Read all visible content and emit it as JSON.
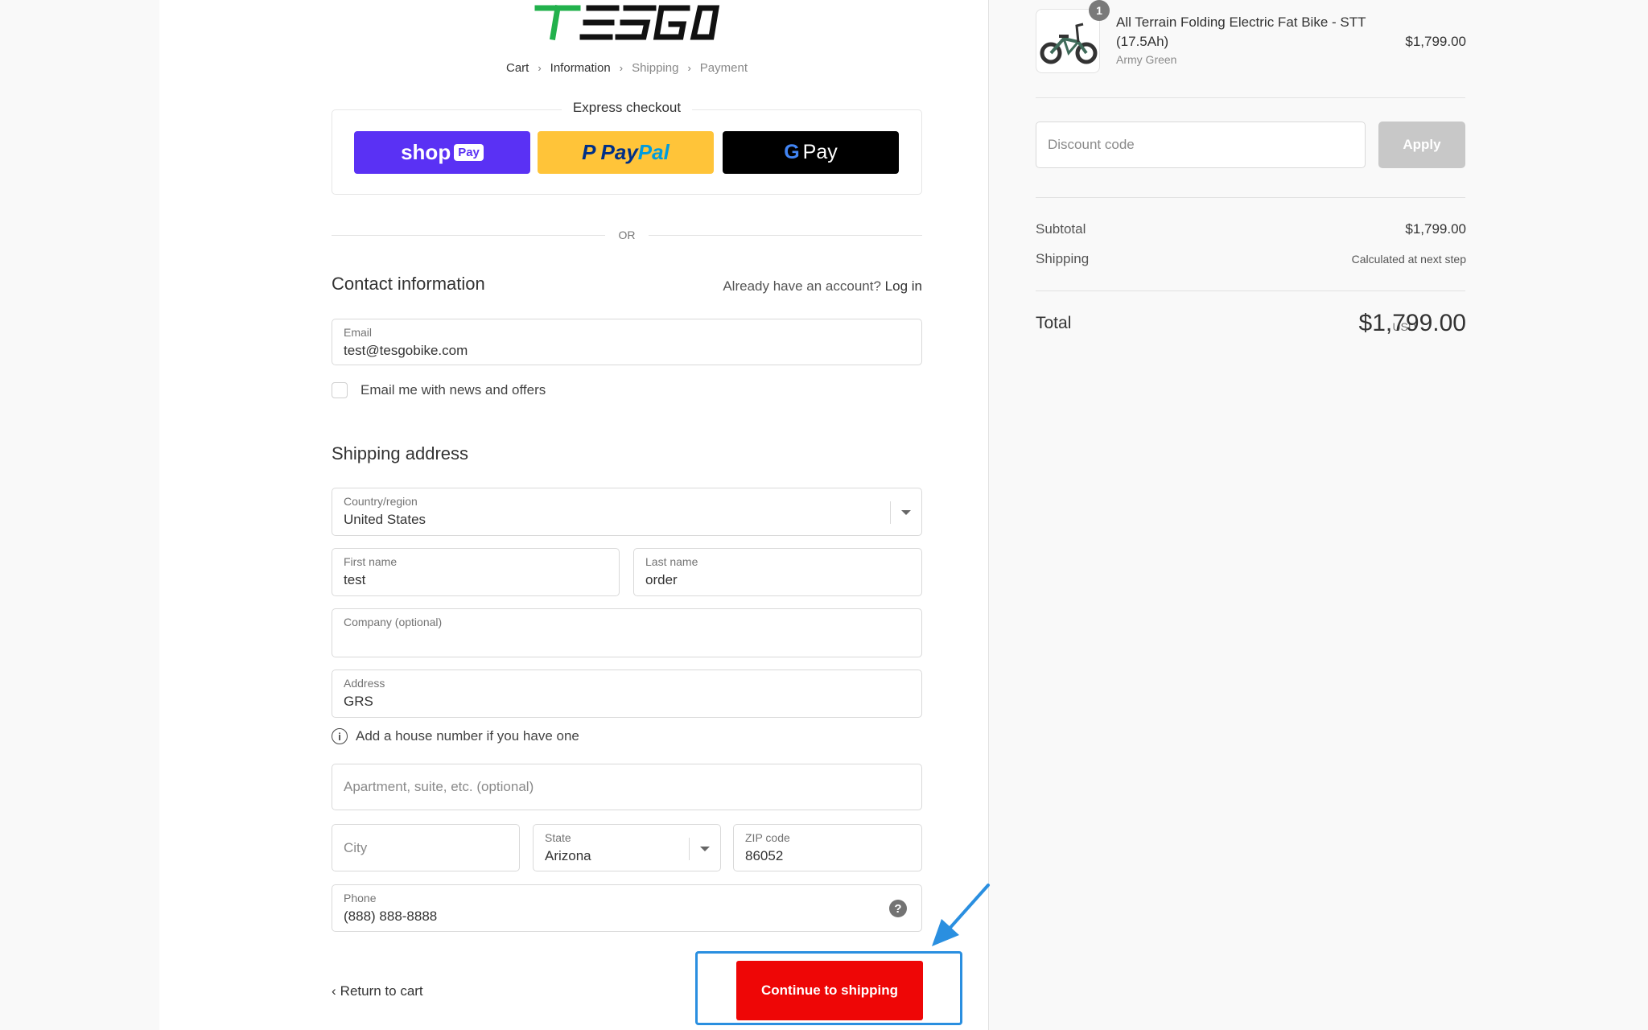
{
  "brand": {
    "logo_text": "TESGO"
  },
  "breadcrumb": [
    "Cart",
    "Information",
    "Shipping",
    "Payment"
  ],
  "express_checkout": {
    "title": "Express checkout",
    "shop_pay": {
      "shop": "shop",
      "pay": "Pay"
    },
    "paypal": {
      "pay": "Pay",
      "pal": "Pal"
    },
    "gpay": {
      "g": "G",
      "pay": "Pay"
    },
    "or": "OR"
  },
  "contact": {
    "title": "Contact information",
    "have_account": "Already have an account?",
    "login": "Log in",
    "email_label": "Email",
    "email_value": "test@tesgobike.com",
    "newsletter": "Email me with news and offers"
  },
  "shipping": {
    "title": "Shipping address",
    "country_label": "Country/region",
    "country_value": "United States",
    "first_name_label": "First name",
    "first_name_value": "test",
    "last_name_label": "Last name",
    "last_name_value": "order",
    "company_label": "Company (optional)",
    "address_label": "Address",
    "address_value": "GRS",
    "address_hint": "Add a house number if you have one",
    "apartment_placeholder": "Apartment, suite, etc. (optional)",
    "city_placeholder": "City",
    "state_label": "State",
    "state_value": "Arizona",
    "zip_label": "ZIP code",
    "zip_value": "86052",
    "phone_label": "Phone",
    "phone_value": "(888) 888-8888"
  },
  "footer": {
    "return_to_cart": "Return to cart",
    "continue": "Continue to shipping"
  },
  "summary": {
    "quantity": "1",
    "product_name": "All Terrain Folding Electric Fat Bike - STT (17.5Ah)",
    "product_variant": "Army Green",
    "product_price": "$1,799.00",
    "discount_placeholder": "Discount code",
    "apply": "Apply",
    "subtotal_label": "Subtotal",
    "subtotal_value": "$1,799.00",
    "shipping_label": "Shipping",
    "shipping_value": "Calculated at next step",
    "total_label": "Total",
    "currency": "USD",
    "total_value": "$1,799.00"
  },
  "colors": {
    "accent_red": "#ee0606",
    "highlight_blue": "#2a8fe0",
    "shop_pay_purple": "#5a31f4",
    "paypal_yellow": "#ffc439",
    "logo_green": "#22b14c"
  }
}
